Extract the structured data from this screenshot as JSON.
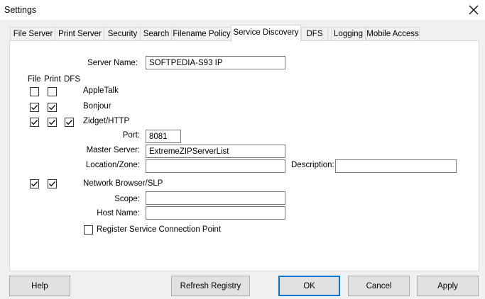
{
  "window": {
    "title": "Settings"
  },
  "tabs": [
    {
      "label": "File Server"
    },
    {
      "label": "Print Server"
    },
    {
      "label": "Security"
    },
    {
      "label": "Search"
    },
    {
      "label": "Filename Policy"
    },
    {
      "label": "Service Discovery",
      "active": true
    },
    {
      "label": "DFS"
    },
    {
      "label": "Logging"
    },
    {
      "label": "Mobile Access"
    }
  ],
  "form": {
    "server_name_label": "Server Name:",
    "server_name_value": "SOFTPEDIA-S93 IP",
    "col_file": "File",
    "col_print": "Print",
    "col_dfs": "DFS",
    "appletalk_label": "AppleTalk",
    "appletalk": {
      "file": false,
      "print": false
    },
    "bonjour_label": "Bonjour",
    "bonjour": {
      "file": true,
      "print": true
    },
    "zidget_label": "Zidget/HTTP",
    "zidget": {
      "file": true,
      "print": true,
      "dfs": true
    },
    "port_label": "Port:",
    "port_value": "8081",
    "master_server_label": "Master Server:",
    "master_server_value": "ExtremeZIPServerList",
    "location_label": "Location/Zone:",
    "location_value": "",
    "description_label": "Description:",
    "description_value": "",
    "netbrowser_label": "Network Browser/SLP",
    "netbrowser": {
      "file": true,
      "print": true
    },
    "scope_label": "Scope:",
    "scope_value": "",
    "hostname_label": "Host Name:",
    "hostname_value": "",
    "register_label": "Register Service Connection Point",
    "register_checked": false
  },
  "buttons": {
    "help": "Help",
    "refresh": "Refresh Registry",
    "ok": "OK",
    "cancel": "Cancel",
    "apply": "Apply"
  },
  "icons": {
    "close": "close-icon",
    "checkmark": "checkmark-icon"
  }
}
